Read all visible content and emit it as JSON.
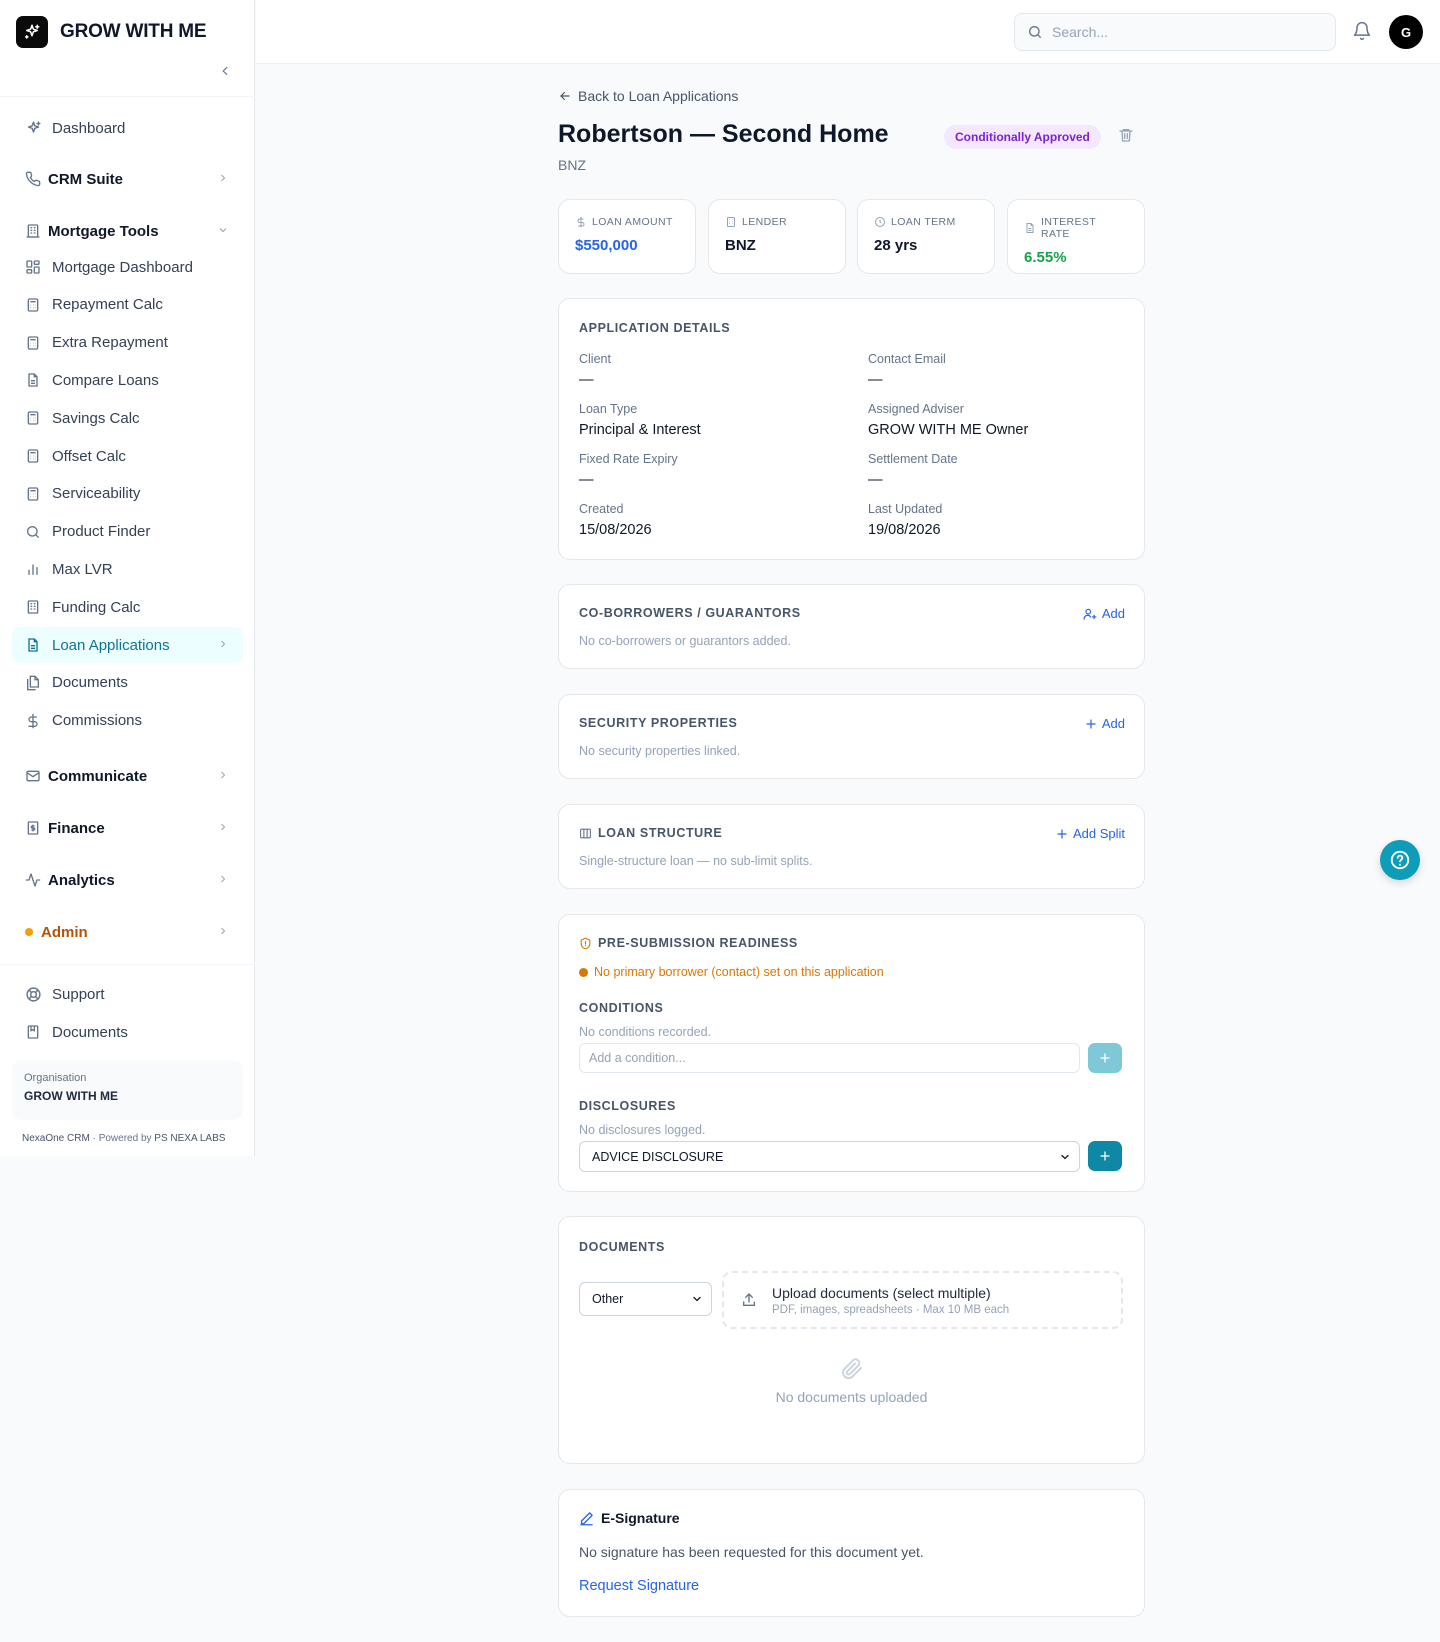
{
  "brand": {
    "name": "GROW WITH ME"
  },
  "sidebar": {
    "dashboard": "Dashboard",
    "crm_suite": "CRM Suite",
    "mortgage_tools": "Mortgage Tools",
    "tools": [
      {
        "label": "Mortgage Dashboard",
        "icon": "grid-icon"
      },
      {
        "label": "Repayment Calc",
        "icon": "calculator-icon"
      },
      {
        "label": "Extra Repayment",
        "icon": "calculator-icon"
      },
      {
        "label": "Compare Loans",
        "icon": "document-icon"
      },
      {
        "label": "Savings Calc",
        "icon": "calculator-icon"
      },
      {
        "label": "Offset Calc",
        "icon": "calculator-icon"
      },
      {
        "label": "Serviceability",
        "icon": "calculator-icon"
      },
      {
        "label": "Product Finder",
        "icon": "search-icon"
      },
      {
        "label": "Max LVR",
        "icon": "bar-chart-icon"
      },
      {
        "label": "Funding Calc",
        "icon": "building-icon"
      },
      {
        "label": "Loan Applications",
        "icon": "document-icon"
      },
      {
        "label": "Documents",
        "icon": "files-icon"
      },
      {
        "label": "Commissions",
        "icon": "dollar-icon"
      }
    ],
    "communicate": "Communicate",
    "finance": "Finance",
    "analytics": "Analytics",
    "admin": "Admin",
    "support": "Support",
    "documents": "Documents",
    "org_label": "Organisation",
    "org_name": "GROW WITH ME",
    "powered_prefix": "NexaOne CRM",
    "powered_mid": " · Powered by ",
    "powered_by": "PS NEXA LABS"
  },
  "topbar": {
    "search_placeholder": "Search...",
    "avatar_initial": "G"
  },
  "page": {
    "back_label": "Back to Loan Applications",
    "title": "Robertson — Second Home",
    "status": "Conditionally Approved",
    "lender_sub": "BNZ"
  },
  "stats": {
    "loan_amount_label": "LOAN AMOUNT",
    "loan_amount": "$550,000",
    "lender_label": "LENDER",
    "lender": "BNZ",
    "term_label": "LOAN TERM",
    "term": "28 yrs",
    "rate_label": "INTEREST RATE",
    "rate": "6.55%"
  },
  "details": {
    "title": "APPLICATION DETAILS",
    "client_k": "Client",
    "client_v": "—",
    "email_k": "Contact Email",
    "email_v": "—",
    "loan_type_k": "Loan Type",
    "loan_type_v": "Principal & Interest",
    "adviser_k": "Assigned Adviser",
    "adviser_v": "GROW WITH ME Owner",
    "fixed_k": "Fixed Rate Expiry",
    "fixed_v": "—",
    "settle_k": "Settlement Date",
    "settle_v": "—",
    "created_k": "Created",
    "created_v": "15/08/2026",
    "updated_k": "Last Updated",
    "updated_v": "19/08/2026"
  },
  "coborrowers": {
    "title": "CO-BORROWERS / GUARANTORS",
    "action": "Add",
    "empty": "No co-borrowers or guarantors added."
  },
  "security": {
    "title": "SECURITY PROPERTIES",
    "action": "Add",
    "empty": "No security properties linked."
  },
  "structure": {
    "title": "LOAN STRUCTURE",
    "action": "Add Split",
    "empty": "Single-structure loan — no sub-limit splits."
  },
  "readiness": {
    "title": "PRE-SUBMISSION READINESS",
    "warning": "No primary borrower (contact) set on this application",
    "conditions_title": "CONDITIONS",
    "conditions_empty": "No conditions recorded.",
    "condition_placeholder": "Add a condition...",
    "disclosures_title": "DISCLOSURES",
    "disclosures_empty": "No disclosures logged.",
    "disclosure_selected": "ADVICE DISCLOSURE"
  },
  "documents": {
    "title": "DOCUMENTS",
    "type_selected": "Other",
    "upload_title": "Upload documents (select multiple)",
    "upload_sub": "PDF, images, spreadsheets · Max 10 MB each",
    "empty": "No documents uploaded"
  },
  "esign": {
    "title": "E-Signature",
    "text": "No signature has been requested for this document yet.",
    "link": "Request Signature"
  },
  "colors": {
    "accent": "#0e7490",
    "primary_blue": "#2563eb",
    "rate_green": "#16a34a",
    "status_purple": "#7e22ce",
    "warning": "#d97706",
    "fab": "#0e9db8"
  }
}
